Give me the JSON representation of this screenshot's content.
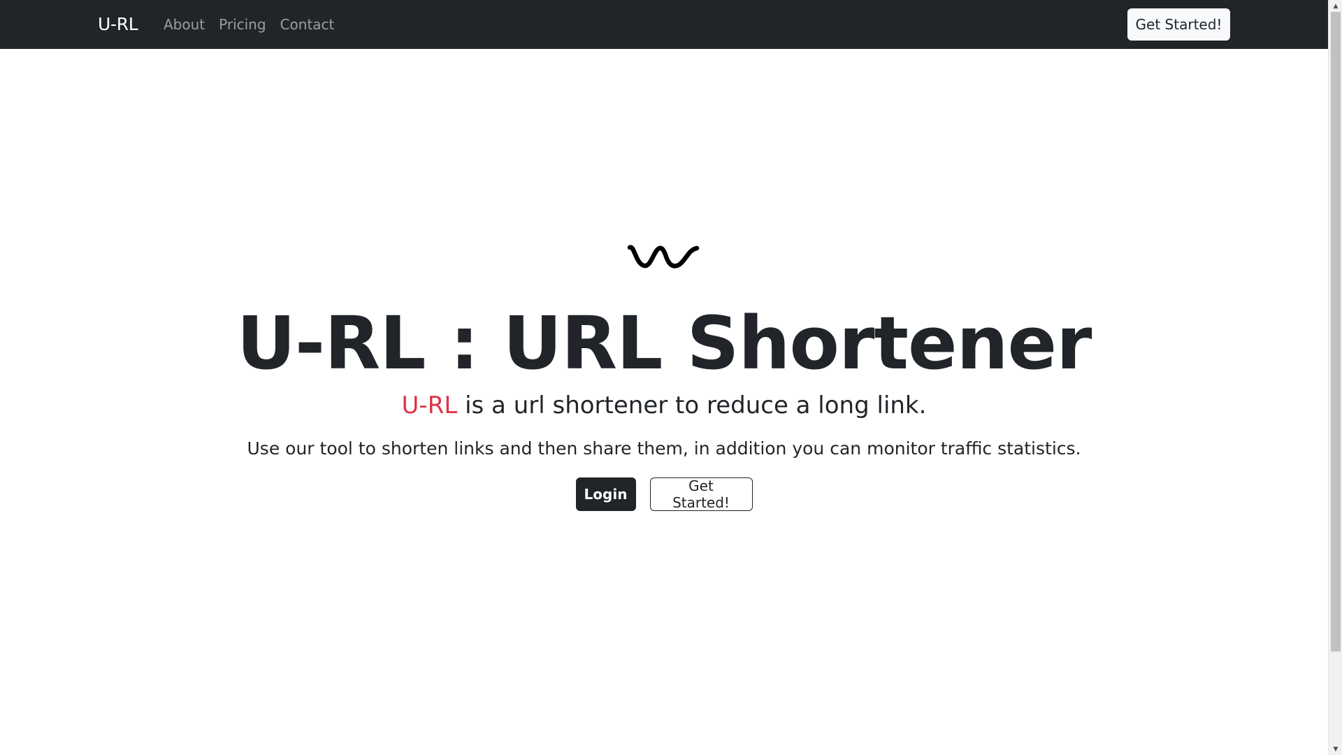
{
  "navbar": {
    "brand": "U-RL",
    "links": [
      "About",
      "Pricing",
      "Contact"
    ],
    "cta_label": "Get Started!"
  },
  "hero": {
    "logo_icon": "wave-logo-icon",
    "title": "U-RL : URL Shortener",
    "lead_accent": "U-RL",
    "lead_rest": " is a url shortener to reduce a long link.",
    "description": "Use our tool to shorten links and then share them, in addition you can monitor traffic statistics.",
    "login_label": "Login",
    "get_started_label": "Get Started!"
  },
  "colors": {
    "navbar_bg": "#212529",
    "accent_red": "#dc3545",
    "text_dark": "#212529"
  }
}
